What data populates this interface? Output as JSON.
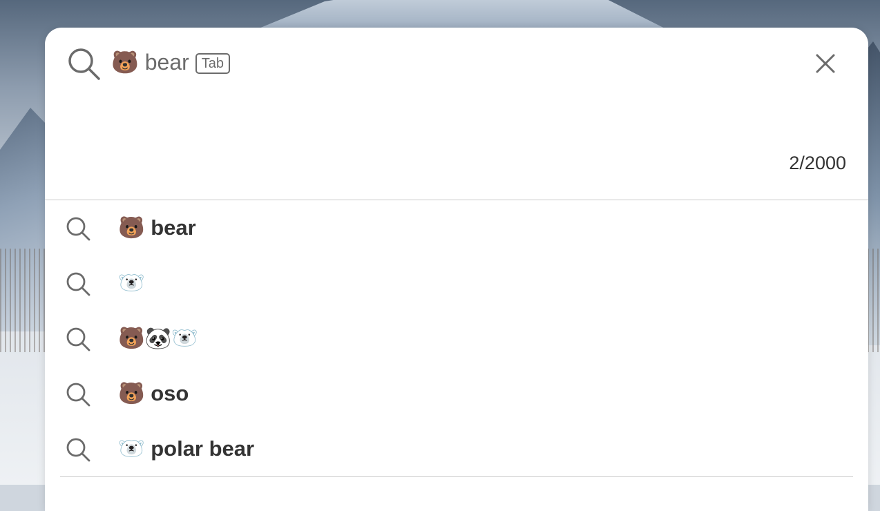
{
  "search": {
    "query": "🐻 bear",
    "tab_hint": "Tab",
    "char_count": "2/2000"
  },
  "suggestions": [
    {
      "text": "🐻 bear"
    },
    {
      "text": "🐻‍❄️"
    },
    {
      "text": "🐻🐼🐻‍❄️"
    },
    {
      "text": "🐻 oso"
    },
    {
      "text": "🐻‍❄️ polar bear"
    }
  ],
  "icons": {
    "search": "search-icon",
    "close": "close-icon"
  },
  "colors": {
    "text": "#333333",
    "muted": "#6b6b6b",
    "divider": "#c8c8c8",
    "panel": "#ffffff"
  }
}
